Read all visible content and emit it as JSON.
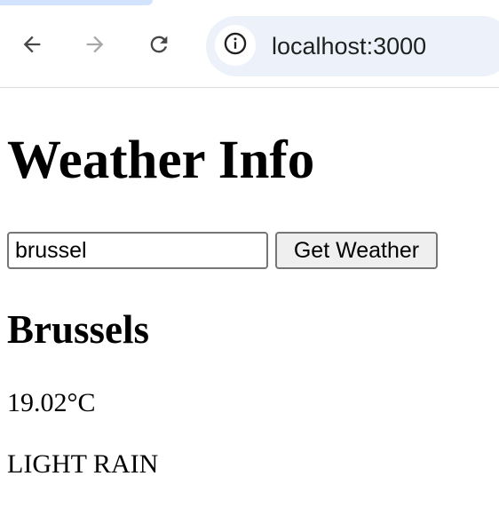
{
  "browser": {
    "url": "localhost:3000",
    "icons": {
      "back": "arrow-left-icon",
      "forward": "arrow-right-icon",
      "reload": "reload-icon",
      "site_info": "info-icon"
    },
    "colors": {
      "tab": "#d3e3fd",
      "omnibox": "#edf2fa"
    }
  },
  "page": {
    "title": "Weather Info",
    "search": {
      "value": "brussel",
      "button_label": "Get Weather"
    },
    "result": {
      "city": "Brussels",
      "temperature": "19.02°C",
      "description": "LIGHT RAIN"
    }
  }
}
